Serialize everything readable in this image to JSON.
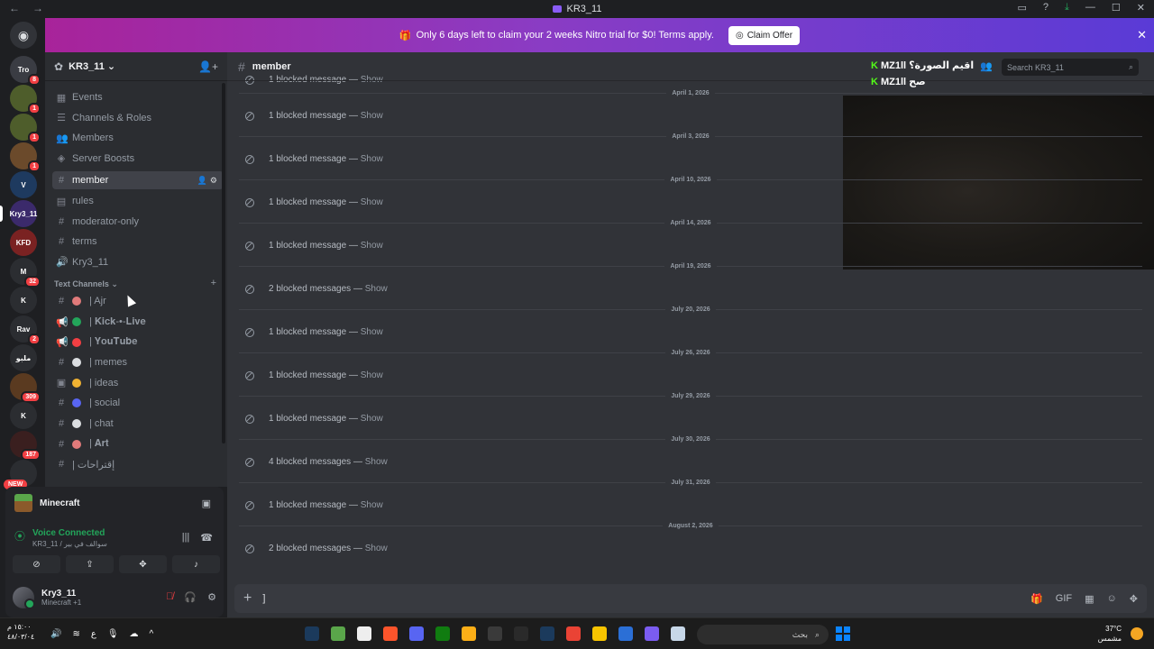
{
  "window": {
    "title": "KR3_11"
  },
  "banner": {
    "message": "Only 6 days left to claim your 2 weeks Nitro trial for $0! Terms apply.",
    "cta": "Claim Offer"
  },
  "guilds": [
    {
      "label": "Tro",
      "badge": "8"
    },
    {
      "label": "",
      "badge": "1"
    },
    {
      "label": "",
      "badge": "1"
    },
    {
      "label": "",
      "badge": "1"
    },
    {
      "label": "V",
      "badge": ""
    },
    {
      "label": "Kry3_11",
      "badge": ""
    },
    {
      "label": "KFD",
      "badge": ""
    },
    {
      "label": "M",
      "badge": "32"
    },
    {
      "label": "K",
      "badge": ""
    },
    {
      "label": "Rav",
      "badge": "2"
    },
    {
      "label": "ملبو",
      "badge": ""
    },
    {
      "label": "",
      "badge": "309"
    },
    {
      "label": "K",
      "badge": ""
    },
    {
      "label": "",
      "badge": "187"
    },
    {
      "label": "",
      "badge": "NEW"
    }
  ],
  "server": {
    "name": "KR3_11",
    "menu": [
      {
        "label": "Events",
        "icon": "calendar-icon"
      },
      {
        "label": "Channels & Roles",
        "icon": "list-icon"
      },
      {
        "label": "Members",
        "icon": "members-icon"
      },
      {
        "label": "Server Boosts",
        "icon": "boost-icon"
      }
    ],
    "channels_top": [
      {
        "label": "member",
        "icon": "#",
        "active": true
      },
      {
        "label": "rules",
        "icon": "rules-icon",
        "active": false
      },
      {
        "label": "moderator-only",
        "icon": "#",
        "active": false
      },
      {
        "label": "terms",
        "icon": "#",
        "active": false
      },
      {
        "label": "Kry3_11",
        "icon": "speaker-icon",
        "active": false
      }
    ],
    "category": "Text Channels",
    "text_channels": [
      {
        "label": "| Ajr",
        "icon": "#",
        "emoji": "#e07a7a"
      },
      {
        "label": "| 𝐊𝐢𝐜𝐤-•-𝐋𝐢𝐯𝐞",
        "icon": "megaphone",
        "emoji": "#23a55a"
      },
      {
        "label": "| 𝐘𝐨𝐮𝐓𝐮𝐛𝐞",
        "icon": "megaphone",
        "emoji": "#f23f43"
      },
      {
        "label": "| memes",
        "icon": "#",
        "emoji": "#dbdee1"
      },
      {
        "label": "| ideas",
        "icon": "forum",
        "emoji": "#f0b232"
      },
      {
        "label": "| social",
        "icon": "#",
        "emoji": "#5865f2"
      },
      {
        "label": "| chat",
        "icon": "#",
        "emoji": "#dbdee1"
      },
      {
        "label": "| 𝐀𝐫𝐭",
        "icon": "#",
        "emoji": "#e07a7a"
      },
      {
        "label": "| إقتراحات",
        "icon": "#",
        "emoji": ""
      }
    ]
  },
  "activity": {
    "game": "Minecraft",
    "voice_status": "Voice Connected",
    "voice_channel": "KR3_11 / سوالف في بير"
  },
  "user": {
    "name": "Kry3_11",
    "status": "Minecraft +1"
  },
  "channel": {
    "name": "member",
    "search_placeholder": "Search KR3_11",
    "overlay_lines": [
      "MZ1ll اقيم الصورة؟",
      "MZ1ll صح"
    ]
  },
  "messages": [
    {
      "type": "blocked",
      "text": "1 blocked message",
      "show": "Show"
    },
    {
      "type": "date",
      "text": "April 1, 2026"
    },
    {
      "type": "blocked",
      "text": "1 blocked message",
      "show": "Show"
    },
    {
      "type": "date",
      "text": "April 3, 2026"
    },
    {
      "type": "blocked",
      "text": "1 blocked message",
      "show": "Show"
    },
    {
      "type": "date",
      "text": "April 10, 2026"
    },
    {
      "type": "blocked",
      "text": "1 blocked message",
      "show": "Show"
    },
    {
      "type": "date",
      "text": "April 14, 2026"
    },
    {
      "type": "blocked",
      "text": "1 blocked message",
      "show": "Show"
    },
    {
      "type": "date",
      "text": "April 19, 2026"
    },
    {
      "type": "blocked",
      "text": "2 blocked messages",
      "show": "Show"
    },
    {
      "type": "date",
      "text": "July 20, 2026"
    },
    {
      "type": "blocked",
      "text": "1 blocked message",
      "show": "Show"
    },
    {
      "type": "date",
      "text": "July 26, 2026"
    },
    {
      "type": "blocked",
      "text": "1 blocked message",
      "show": "Show"
    },
    {
      "type": "date",
      "text": "July 29, 2026"
    },
    {
      "type": "blocked",
      "text": "1 blocked message",
      "show": "Show"
    },
    {
      "type": "date",
      "text": "July 30, 2026"
    },
    {
      "type": "blocked",
      "text": "4 blocked messages",
      "show": "Show"
    },
    {
      "type": "date",
      "text": "July 31, 2026"
    },
    {
      "type": "blocked",
      "text": "1 blocked message",
      "show": "Show"
    },
    {
      "type": "date",
      "text": "August 2, 2026"
    },
    {
      "type": "blocked",
      "text": "2 blocked messages",
      "show": "Show"
    }
  ],
  "composer": {
    "value": "]"
  },
  "taskbar": {
    "clock": "١٥:٠٠ م",
    "date": "٤٨/٠٣/٠٤",
    "lang": "ع",
    "search_placeholder": "بحث",
    "temp": "37°C",
    "weather": "مشمس"
  }
}
